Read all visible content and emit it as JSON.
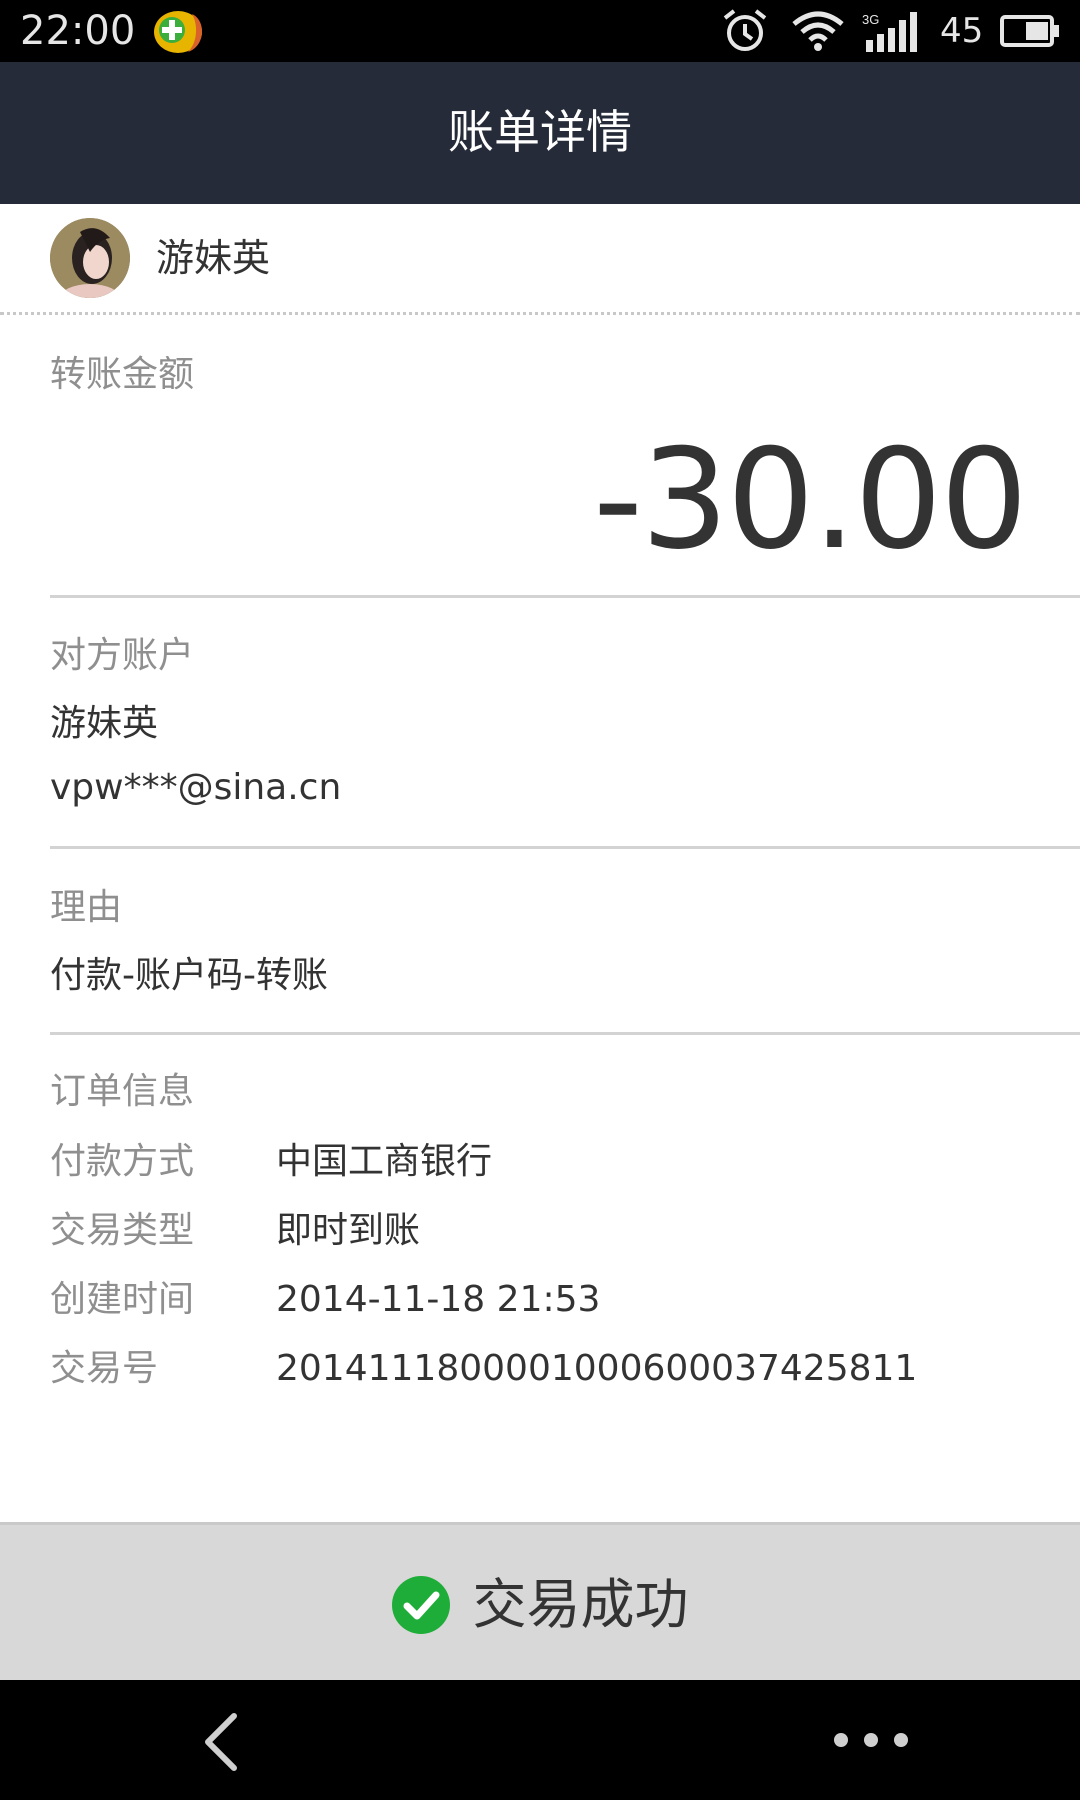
{
  "status_bar": {
    "time": "22:00",
    "battery_level": "45",
    "network_type": "3G",
    "icons": [
      "app-notification-icon",
      "alarm-icon",
      "wifi-icon",
      "signal-icon",
      "battery-icon"
    ]
  },
  "header": {
    "title": "账单详情"
  },
  "payee": {
    "name": "游妹英",
    "avatar_icon": "avatar"
  },
  "amount_section": {
    "label": "转账金额",
    "amount": "-30.00"
  },
  "counterparty": {
    "label": "对方账户",
    "name": "游妹英",
    "account": "vpw***@sina.cn"
  },
  "reason": {
    "label": "理由",
    "value": "付款-账户码-转账"
  },
  "order_info": {
    "label": "订单信息",
    "rows": [
      {
        "label": "付款方式",
        "value": "中国工商银行"
      },
      {
        "label": "交易类型",
        "value": "即时到账"
      },
      {
        "label": "创建时间",
        "value": "2014-11-18 21:53"
      },
      {
        "label": "交易号",
        "value": "2014111800001000600037425811"
      }
    ]
  },
  "footer": {
    "status_text": "交易成功",
    "status_icon": "check-circle-icon",
    "status_color": "#1fad3a"
  },
  "nav": {
    "back_icon": "back-icon",
    "more_icon": "more-icon"
  },
  "colors": {
    "header_bg": "#252b38",
    "status_bar_bg": "#000000",
    "footer_bg": "#d8d8d8"
  }
}
